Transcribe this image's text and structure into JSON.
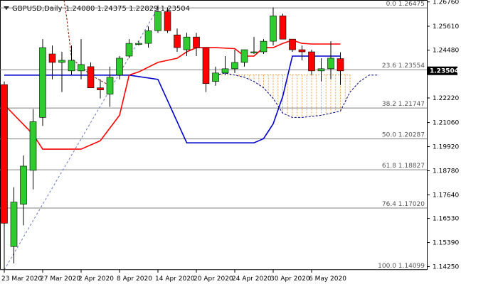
{
  "header": {
    "symbol": "GBPUSD,Daily",
    "ohlc": "1.24080 1.24375 1.22829 1.23504"
  },
  "chart_data": {
    "type": "candlestick",
    "price_range": [
      1.141,
      1.2685
    ],
    "y_ticks": [
      "1.26760",
      "1.25610",
      "1.24480",
      "1.22220",
      "1.21060",
      "1.19920",
      "1.18780",
      "1.17640",
      "1.16530",
      "1.15390",
      "1.14250"
    ],
    "x_ticks": [
      "23 Mar 2020",
      "27 Mar 2020",
      "2 Apr 2020",
      "8 Apr 2020",
      "14 Apr 2020",
      "20 Apr 2020",
      "24 Apr 2020",
      "30 Apr 2020",
      "6 May 2020"
    ],
    "x_tick_index": [
      0,
      4,
      8,
      12,
      16,
      20,
      24,
      28,
      32
    ],
    "current_price": "1.23504",
    "candles": [
      {
        "o": 1.2285,
        "h": 1.23,
        "l": 1.141,
        "c": 1.163
      },
      {
        "o": 1.152,
        "h": 1.18,
        "l": 1.144,
        "c": 1.173
      },
      {
        "o": 1.172,
        "h": 1.195,
        "l": 1.162,
        "c": 1.19
      },
      {
        "o": 1.188,
        "h": 1.217,
        "l": 1.179,
        "c": 1.211
      },
      {
        "o": 1.213,
        "h": 1.25,
        "l": 1.209,
        "c": 1.246
      },
      {
        "o": 1.243,
        "h": 1.247,
        "l": 1.231,
        "c": 1.239
      },
      {
        "o": 1.239,
        "h": 1.244,
        "l": 1.225,
        "c": 1.24
      },
      {
        "o": 1.235,
        "h": 1.247,
        "l": 1.233,
        "c": 1.24
      },
      {
        "o": 1.235,
        "h": 1.25,
        "l": 1.231,
        "c": 1.238
      },
      {
        "o": 1.237,
        "h": 1.239,
        "l": 1.229,
        "c": 1.227
      },
      {
        "o": 1.227,
        "h": 1.231,
        "l": 1.222,
        "c": 1.226
      },
      {
        "o": 1.224,
        "h": 1.237,
        "l": 1.218,
        "c": 1.232
      },
      {
        "o": 1.233,
        "h": 1.242,
        "l": 1.231,
        "c": 1.241
      },
      {
        "o": 1.242,
        "h": 1.25,
        "l": 1.241,
        "c": 1.248
      },
      {
        "o": 1.248,
        "h": 1.249,
        "l": 1.247,
        "c": 1.248
      },
      {
        "o": 1.248,
        "h": 1.256,
        "l": 1.246,
        "c": 1.254
      },
      {
        "o": 1.254,
        "h": 1.266,
        "l": 1.253,
        "c": 1.263
      },
      {
        "o": 1.263,
        "h": 1.265,
        "l": 1.253,
        "c": 1.254
      },
      {
        "o": 1.252,
        "h": 1.255,
        "l": 1.244,
        "c": 1.246
      },
      {
        "o": 1.245,
        "h": 1.253,
        "l": 1.242,
        "c": 1.251
      },
      {
        "o": 1.251,
        "h": 1.253,
        "l": 1.242,
        "c": 1.246
      },
      {
        "o": 1.246,
        "h": 1.246,
        "l": 1.225,
        "c": 1.229
      },
      {
        "o": 1.23,
        "h": 1.237,
        "l": 1.228,
        "c": 1.234
      },
      {
        "o": 1.234,
        "h": 1.242,
        "l": 1.233,
        "c": 1.236
      },
      {
        "o": 1.236,
        "h": 1.245,
        "l": 1.234,
        "c": 1.239
      },
      {
        "o": 1.239,
        "h": 1.245,
        "l": 1.237,
        "c": 1.245
      },
      {
        "o": 1.244,
        "h": 1.251,
        "l": 1.243,
        "c": 1.244
      },
      {
        "o": 1.244,
        "h": 1.25,
        "l": 1.243,
        "c": 1.249
      },
      {
        "o": 1.249,
        "h": 1.265,
        "l": 1.247,
        "c": 1.261
      },
      {
        "o": 1.261,
        "h": 1.262,
        "l": 1.25,
        "c": 1.25
      },
      {
        "o": 1.25,
        "h": 1.25,
        "l": 1.244,
        "c": 1.245
      },
      {
        "o": 1.245,
        "h": 1.247,
        "l": 1.24,
        "c": 1.244
      },
      {
        "o": 1.244,
        "h": 1.245,
        "l": 1.233,
        "c": 1.235
      },
      {
        "o": 1.235,
        "h": 1.241,
        "l": 1.23,
        "c": 1.236
      },
      {
        "o": 1.236,
        "h": 1.249,
        "l": 1.231,
        "c": 1.241
      },
      {
        "o": 1.2408,
        "h": 1.2438,
        "l": 1.2283,
        "c": 1.235
      }
    ],
    "tenkan": [
      [
        0,
        1.219
      ],
      [
        3,
        1.205
      ],
      [
        4,
        1.198
      ],
      [
        8,
        1.198
      ],
      [
        10,
        1.202
      ],
      [
        12,
        1.214
      ],
      [
        13,
        1.233
      ],
      [
        14,
        1.2345
      ],
      [
        16,
        1.239
      ],
      [
        18,
        1.241
      ],
      [
        19,
        1.244
      ],
      [
        20,
        1.246
      ],
      [
        22,
        1.246
      ],
      [
        24,
        1.2455
      ],
      [
        25,
        1.242
      ],
      [
        26,
        1.242
      ],
      [
        27,
        1.246
      ],
      [
        28,
        1.246
      ],
      [
        29,
        1.248
      ],
      [
        30,
        1.2495
      ],
      [
        31,
        1.248
      ],
      [
        32,
        1.2477
      ],
      [
        35,
        1.2477
      ]
    ],
    "kijun": [
      [
        0,
        1.233
      ],
      [
        13,
        1.233
      ],
      [
        16,
        1.231
      ],
      [
        19,
        1.201
      ],
      [
        26,
        1.201
      ],
      [
        27,
        1.203
      ],
      [
        28,
        1.21
      ],
      [
        29,
        1.223
      ],
      [
        30,
        1.242
      ],
      [
        31,
        1.242
      ],
      [
        35,
        1.242
      ]
    ],
    "cloud_span": [
      [
        22,
        1.233
      ],
      [
        23,
        1.234
      ],
      [
        25,
        1.232
      ],
      [
        26,
        1.23
      ],
      [
        27,
        1.227
      ],
      [
        28,
        1.222
      ],
      [
        29,
        1.215
      ],
      [
        30,
        1.213
      ],
      [
        31,
        1.213
      ],
      [
        33,
        1.214
      ],
      [
        35,
        1.216
      ],
      [
        36,
        1.225
      ],
      [
        37,
        1.23
      ],
      [
        38,
        1.233
      ],
      [
        39,
        1.233
      ]
    ],
    "chikou": [
      [
        3,
        1.298
      ],
      [
        4,
        1.288
      ],
      [
        6,
        1.275
      ],
      [
        6.5,
        1.26
      ],
      [
        7,
        1.241
      ],
      [
        9,
        1.233
      ],
      [
        11,
        1.228
      ]
    ],
    "cloud_region": {
      "x_start": 22,
      "x_end": 36,
      "upper": 1.2331
    },
    "fib_levels": [
      {
        "label": "0.0 1.26475",
        "price": 1.26475
      },
      {
        "label": "23.6 1.23554",
        "price": 1.23554
      },
      {
        "label": "38.2 1.21747",
        "price": 1.21747
      },
      {
        "label": "50.0 1.20287",
        "price": 1.20287
      },
      {
        "label": "61.8 1.18827",
        "price": 1.18827
      },
      {
        "label": "76.4 1.17020",
        "price": 1.1702
      },
      {
        "label": "100.0 1.14099",
        "price": 1.14099
      }
    ],
    "fib_trendline": {
      "x1": 0,
      "y1": 1.14099,
      "x2": 16,
      "y2": 1.26475
    },
    "colors": {
      "bull": "#2ecc2e",
      "bear": "#ff0000",
      "tenkan": "#ff0000",
      "kijun": "#0000cc",
      "chikou": "#8b1a00",
      "cloud_line": "#000080",
      "cloud_fill": "#e8a040",
      "fib_line": "#808080",
      "fib_trend": "#6677bb",
      "grid": "#000000"
    }
  }
}
